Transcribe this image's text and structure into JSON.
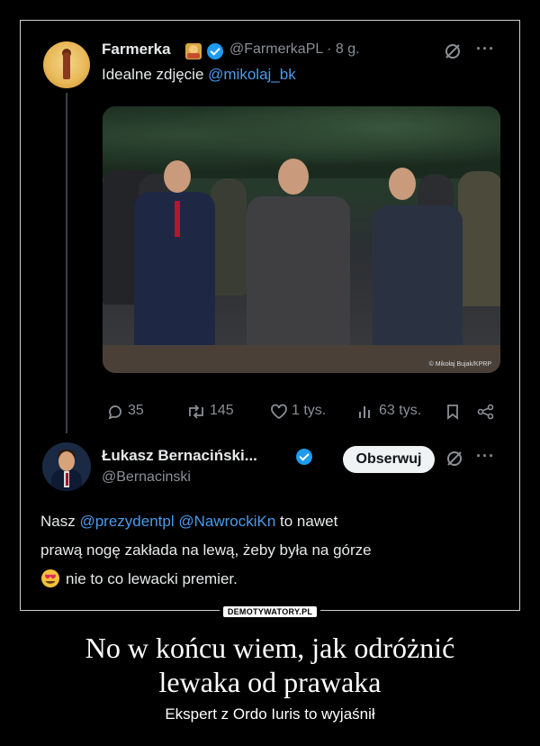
{
  "tweet1": {
    "name": "Farmerka",
    "handle_time": "@FarmerkaPL · 8 g.",
    "text_prefix": "Idealne zdjęcie ",
    "mention": "@mikolaj_bk",
    "photo_credit": "© Mikołaj Bujak/KPRP",
    "stats": {
      "replies": "35",
      "retweets": "145",
      "likes": "1 tys.",
      "views": "63 tys."
    }
  },
  "tweet2": {
    "name": "Łukasz Bernaciński...",
    "handle": "@Bernacinski",
    "follow_label": "Obserwuj",
    "line1_mention1": "@prezydentpl",
    "line1_mention2": "@NawrockiKn",
    "line1_prefix": "Nasz ",
    "line1_suffix": " to nawet",
    "line2": "prawą nogę zakłada na lewą, żeby była na górze",
    "line3": "nie to co lewacki premier."
  },
  "icons": [
    "verified-badge",
    "grok-icon",
    "more-icon",
    "reply-icon",
    "retweet-icon",
    "like-icon",
    "views-icon",
    "bookmark-icon",
    "share-icon",
    "heart-eyes-emoji"
  ],
  "watermark": "DEMOTYWATORY.PL",
  "caption": {
    "title_line1": "No w końcu wiem, jak odróżnić",
    "title_line2": "lewaka od prawaka",
    "subtitle": "Ekspert z Ordo Iuris to wyjaśnił"
  },
  "colors": {
    "background": "#000000",
    "text": "#e7e9ea",
    "secondary": "#8b9096",
    "mention": "#4a9bea",
    "verified": "#1d9bf0"
  }
}
